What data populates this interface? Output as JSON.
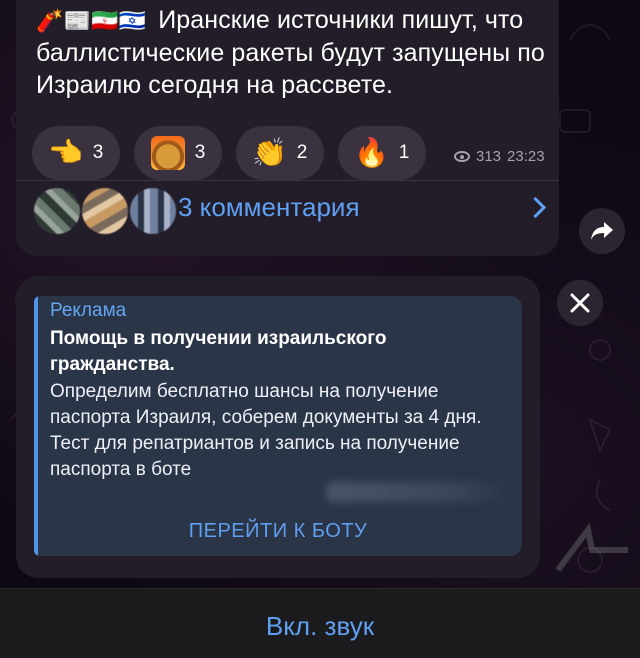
{
  "post": {
    "text": "Иранские источники пишут, что баллистические ракеты будут запущены по Израилю сегодня на рассвете.",
    "prefix_icons": [
      "missile-icon",
      "newspaper-icon",
      "iran-flag-icon",
      "israel-flag-icon"
    ],
    "views": "313",
    "time": "23:23",
    "reactions": [
      {
        "icon": "pointing-hand-icon",
        "count": "3"
      },
      {
        "icon": "this-is-fine-dog-icon",
        "count": "3"
      },
      {
        "icon": "clapping-hands-icon",
        "count": "2"
      },
      {
        "icon": "fire-icon",
        "count": "1"
      }
    ],
    "comments_label": "3 комментария"
  },
  "ad": {
    "label": "Реклама",
    "title": "Помощь в получении израильского гражданства.",
    "body": "Определим бесплатно шансы на получение паспорта Израиля, соберем документы за 4 дня. Тест для репатриантов и запись на получение паспорта в боте",
    "button_label": "ПЕРЕЙТИ К БОТУ"
  },
  "bottom_bar": {
    "label": "Вкл. звук"
  },
  "colors": {
    "accent": "#5fa0f2",
    "bubble": "#231d29",
    "ad_card": "#2b3548",
    "reaction_bg": "#3a333f"
  }
}
